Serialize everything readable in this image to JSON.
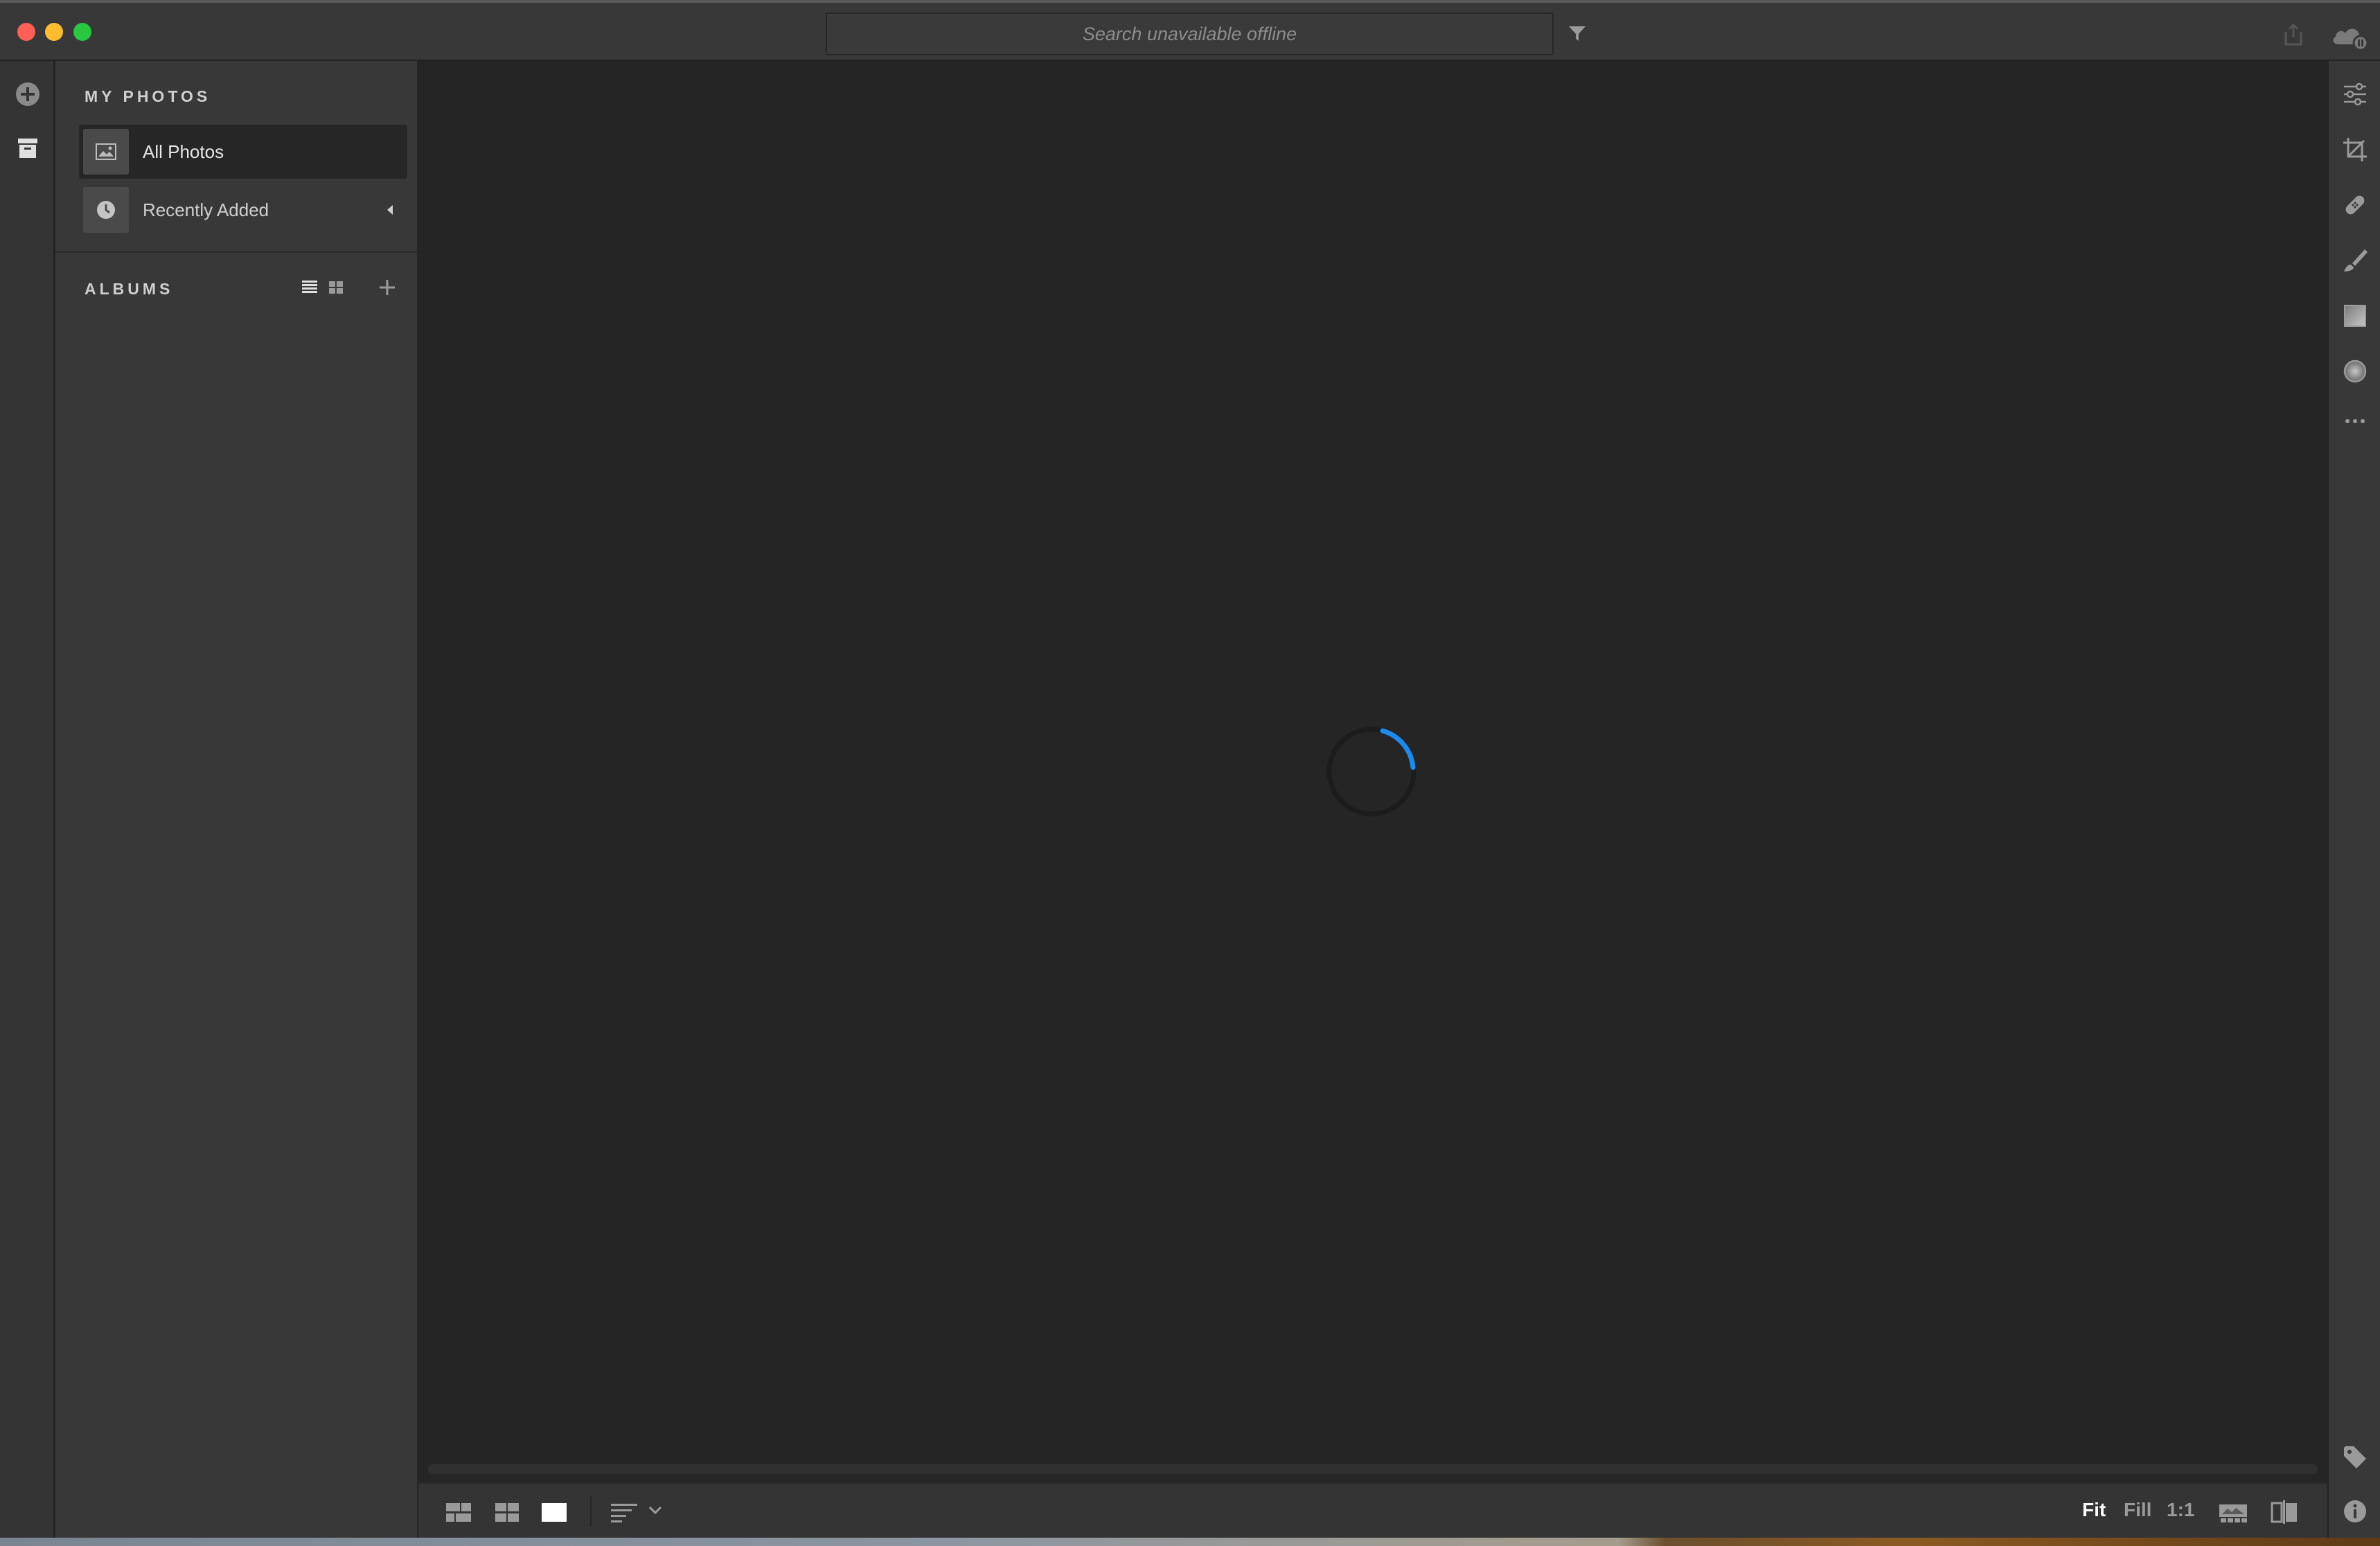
{
  "window": {
    "search_placeholder": "Search unavailable offline"
  },
  "sidebar": {
    "my_photos_title": "MY PHOTOS",
    "items": [
      {
        "label": "All Photos",
        "icon": "image-icon",
        "active": true
      },
      {
        "label": "Recently Added",
        "icon": "clock-icon",
        "active": false
      }
    ],
    "albums_title": "ALBUMS"
  },
  "main": {
    "state": "loading",
    "spinner_color": "#1a8cf0"
  },
  "bottom_toolbar": {
    "zoom_options": [
      "Fit",
      "Fill",
      "1:1"
    ],
    "zoom_selected": "Fit"
  },
  "tools": [
    "edit-sliders-icon",
    "crop-icon",
    "healing-icon",
    "brush-icon",
    "linear-gradient-icon",
    "radial-gradient-icon",
    "more-icon",
    "tag-icon",
    "info-icon"
  ]
}
